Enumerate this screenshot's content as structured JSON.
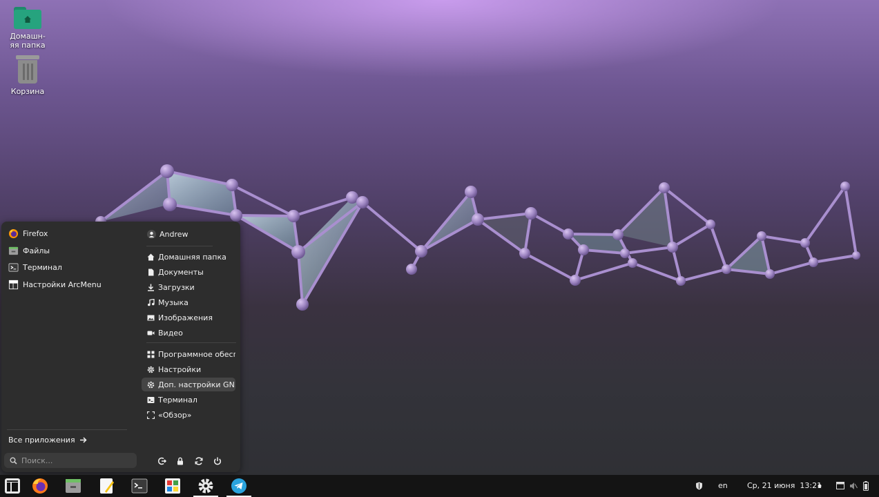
{
  "desktop": {
    "icons": [
      {
        "label": "Домашн-\nяя папка",
        "icon": "home-folder-icon"
      },
      {
        "label": "Корзина",
        "icon": "trash-icon"
      }
    ]
  },
  "arcmenu": {
    "pinned": [
      {
        "label": "Firefox",
        "icon": "firefox-icon"
      },
      {
        "label": "Файлы",
        "icon": "files-icon"
      },
      {
        "label": "Терминал",
        "icon": "terminal-icon"
      },
      {
        "label": "Настройки ArcMenu",
        "icon": "arcmenu-settings-icon"
      }
    ],
    "user": {
      "name": "Andrew",
      "icon": "user-icon"
    },
    "places": [
      {
        "label": "Домашняя папка",
        "icon": "home-icon"
      },
      {
        "label": "Документы",
        "icon": "document-icon"
      },
      {
        "label": "Загрузки",
        "icon": "download-icon"
      },
      {
        "label": "Музыка",
        "icon": "music-icon"
      },
      {
        "label": "Изображения",
        "icon": "image-icon"
      },
      {
        "label": "Видео",
        "icon": "video-icon"
      }
    ],
    "shortcuts": [
      {
        "label": "Программное обесп...",
        "icon": "software-icon"
      },
      {
        "label": "Настройки",
        "icon": "settings-icon"
      },
      {
        "label": "Доп. настройки GN...",
        "icon": "tweaks-icon"
      },
      {
        "label": "Терминал",
        "icon": "terminal-icon"
      },
      {
        "label": "«Обзор»",
        "icon": "overview-icon"
      }
    ],
    "all_apps_label": "Все приложения",
    "search_placeholder": "Поиск...",
    "power_buttons": [
      "logout-icon",
      "lock-icon",
      "restart-icon",
      "power-icon"
    ]
  },
  "taskbar": {
    "apps": [
      "arcmenu-icon",
      "firefox-icon",
      "files-icon",
      "text-editor-icon",
      "terminal-icon",
      "software-icon",
      "settings-icon",
      "telegram-icon"
    ],
    "keyboard_layout": "en",
    "clock": "Ср, 21 июня  13:21",
    "tray_icons": [
      "shield-icon",
      "dot-icon",
      "window-icon",
      "mute-icon",
      "battery-icon"
    ]
  },
  "colors": {
    "accent": "#26a37e",
    "menu_bg": "#2d2d2d",
    "taskbar_bg": "#141414",
    "telegram": "#2aa3dd"
  }
}
